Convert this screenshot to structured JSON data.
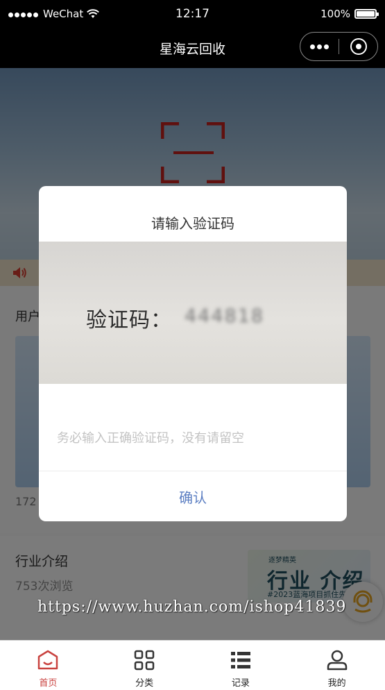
{
  "status_bar": {
    "carrier": "WeChat",
    "time": "12:17",
    "battery": "100%"
  },
  "nav": {
    "title": "星海云回收"
  },
  "background": {
    "section1_title": "用户",
    "section1_views": "172",
    "section2_title": "行业介绍",
    "section2_views": "753次浏览",
    "promo_image": {
      "top_text": "逐梦精英",
      "main_text": "行业 介绍",
      "sub_text": "#2023蓝海项目抓住先机"
    }
  },
  "modal": {
    "title": "请输入验证码",
    "photo_label": "验证码：",
    "photo_code": "444818",
    "input_placeholder": "务必输入正确验证码，没有请留空",
    "input_value": "",
    "confirm_label": "确认"
  },
  "watermark": "https://www.huzhan.com/ishop41839",
  "tabbar": {
    "active_color": "#c9423f",
    "items": [
      {
        "label": "首页",
        "icon": "home-icon",
        "active": true
      },
      {
        "label": "分类",
        "icon": "category-grid-icon",
        "active": false
      },
      {
        "label": "记录",
        "icon": "list-icon",
        "active": false
      },
      {
        "label": "我的",
        "icon": "user-icon",
        "active": false
      }
    ]
  }
}
